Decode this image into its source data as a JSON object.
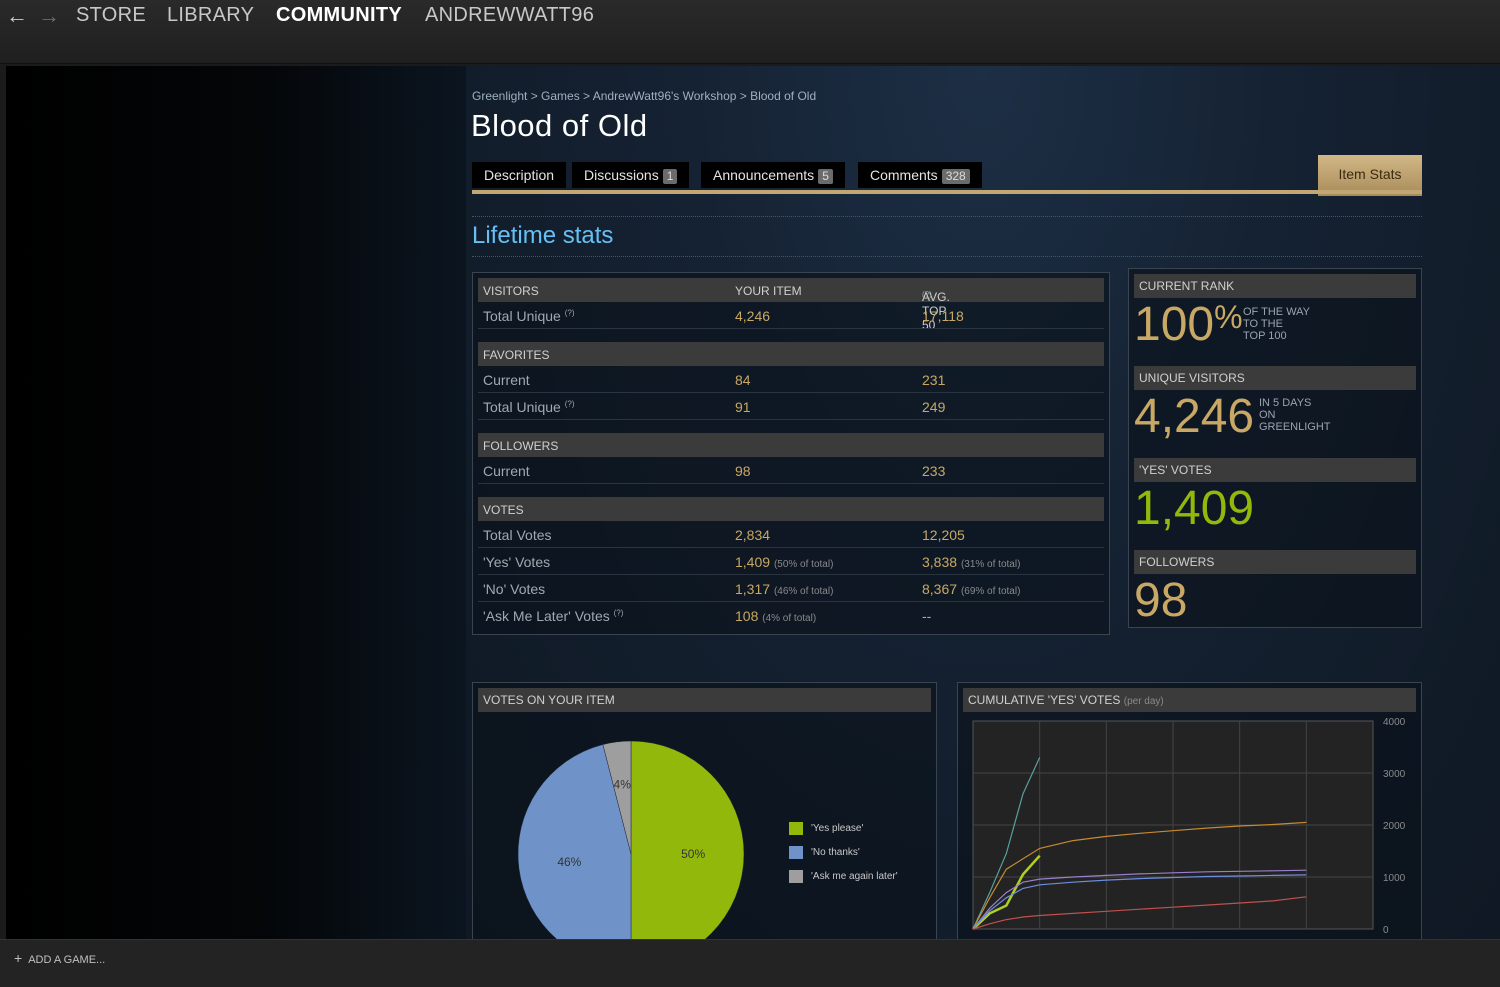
{
  "nav": {
    "back": "←",
    "forward": "→",
    "links": [
      "STORE",
      "LIBRARY",
      "COMMUNITY",
      "ANDREWWATT96"
    ]
  },
  "breadcrumb": "Greenlight > Games > AndrewWatt96's Workshop > Blood of Old",
  "title": "Blood of Old",
  "tabs": {
    "description": "Description",
    "discussions": "Discussions",
    "discussions_count": "1",
    "announcements": "Announcements",
    "announcements_count": "5",
    "comments": "Comments",
    "comments_count": "328",
    "item_stats": "Item Stats"
  },
  "lifetime_title": "Lifetime stats",
  "table": {
    "col_your": "YOUR ITEM",
    "col_avg": "AVG. TOP 50",
    "q": "(?)",
    "visitors": "VISITORS",
    "visitors_total_label": "Total Unique",
    "visitors_total_your": "4,246",
    "visitors_total_avg": "17,118",
    "favorites": "FAVORITES",
    "fav_current_label": "Current",
    "fav_current_your": "84",
    "fav_current_avg": "231",
    "fav_total_label": "Total Unique",
    "fav_total_your": "91",
    "fav_total_avg": "249",
    "followers": "FOLLOWERS",
    "fol_current_label": "Current",
    "fol_current_your": "98",
    "fol_current_avg": "233",
    "votes": "VOTES",
    "votes_total_label": "Total Votes",
    "votes_total_your": "2,834",
    "votes_total_avg": "12,205",
    "yes_label": "'Yes' Votes",
    "yes_your": "1,409",
    "yes_your_pct": "(50% of total)",
    "yes_avg": "3,838",
    "yes_avg_pct": "(31% of total)",
    "no_label": "'No' Votes",
    "no_your": "1,317",
    "no_your_pct": "(46% of total)",
    "no_avg": "8,367",
    "no_avg_pct": "(69% of total)",
    "later_label": "'Ask Me Later' Votes",
    "later_your": "108",
    "later_your_pct": "(4% of total)",
    "later_avg": "--"
  },
  "side": {
    "rank_header": "CURRENT RANK",
    "rank_value": "100",
    "rank_pct": "%",
    "rank_note1": "OF THE WAY",
    "rank_note2": "TO THE",
    "rank_note3": "TOP 100",
    "visitors_header": "UNIQUE VISITORS",
    "visitors_value": "4,246",
    "visitors_note1": "IN 5 DAYS",
    "visitors_note2": "ON",
    "visitors_note3": "GREENLIGHT",
    "yes_header": "'YES' VOTES",
    "yes_value": "1,409",
    "followers_header": "FOLLOWERS",
    "followers_value": "98"
  },
  "pie": {
    "header": "VOTES ON YOUR ITEM",
    "legend": [
      "'Yes please'",
      "'No thanks'",
      "'Ask me again later'"
    ]
  },
  "line": {
    "header": "CUMULATIVE 'YES' VOTES",
    "header_sub": "(per day)"
  },
  "chart_data": [
    {
      "type": "pie",
      "title": "VOTES ON YOUR ITEM",
      "categories": [
        "'Yes please'",
        "'No thanks'",
        "'Ask me again later'"
      ],
      "values": [
        50,
        46,
        4
      ],
      "labels": [
        "50%",
        "46%",
        "4%"
      ],
      "colors": [
        "#93b80c",
        "#6f93c8",
        "#9e9e9e"
      ]
    },
    {
      "type": "line",
      "title": "CUMULATIVE 'YES' VOTES (per day)",
      "ylim": [
        0,
        4000
      ],
      "yticks": [
        "4000",
        "3000",
        "2000",
        "1000",
        "0"
      ],
      "series": [
        {
          "color": "#5aa0a0",
          "x": [
            0,
            0.5,
            1,
            1.5,
            2
          ],
          "values": [
            0,
            700,
            1450,
            2600,
            3300
          ]
        },
        {
          "color": "#c68a2e",
          "x": [
            0,
            0.5,
            1,
            1.5,
            2,
            3,
            4,
            5,
            6,
            7,
            8,
            9,
            10
          ],
          "values": [
            0,
            600,
            1150,
            1350,
            1550,
            1700,
            1780,
            1840,
            1890,
            1940,
            1980,
            2010,
            2050
          ]
        },
        {
          "color": "#b0d020",
          "x": [
            0,
            0.5,
            1,
            1.5,
            2
          ],
          "values": [
            0,
            300,
            450,
            1050,
            1409
          ]
        },
        {
          "color": "#9b7fc9",
          "x": [
            0,
            0.5,
            1,
            1.5,
            2,
            3,
            4,
            5,
            6,
            7,
            8,
            9,
            10
          ],
          "values": [
            0,
            400,
            700,
            900,
            960,
            1000,
            1030,
            1060,
            1080,
            1100,
            1110,
            1120,
            1130
          ]
        },
        {
          "color": "#6c8ee0",
          "x": [
            0,
            0.5,
            1,
            1.5,
            2,
            3,
            4,
            5,
            6,
            7,
            8,
            9,
            10
          ],
          "values": [
            0,
            350,
            600,
            780,
            850,
            900,
            940,
            970,
            990,
            1010,
            1020,
            1030,
            1040
          ]
        },
        {
          "color": "#c05050",
          "x": [
            0,
            0.5,
            1,
            1.5,
            2,
            3,
            4,
            5,
            6,
            7,
            8,
            9,
            10
          ],
          "values": [
            0,
            100,
            180,
            230,
            260,
            300,
            340,
            380,
            420,
            460,
            500,
            540,
            620
          ]
        }
      ]
    }
  ]
}
